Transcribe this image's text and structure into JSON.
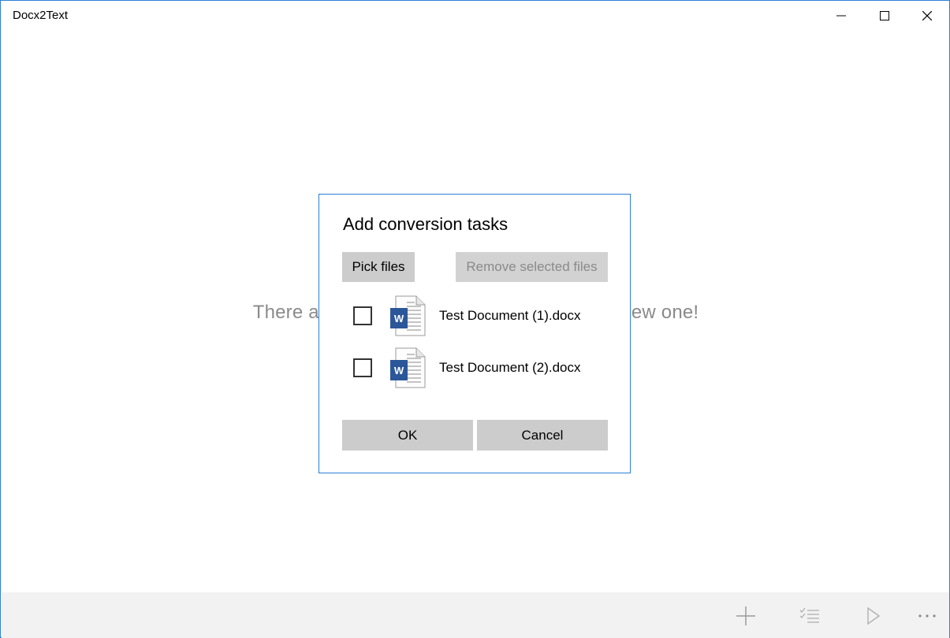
{
  "window": {
    "title": "Docx2Text",
    "controls": {
      "minimize_icon": "minimize-icon",
      "maximize_icon": "maximize-icon",
      "close_icon": "close-icon"
    }
  },
  "main": {
    "empty_message_left": "There a",
    "empty_message_right": "ew one!"
  },
  "command_bar": {
    "items": [
      {
        "icon": "add-icon"
      },
      {
        "icon": "select-all-icon"
      },
      {
        "icon": "play-icon"
      },
      {
        "icon": "more-icon"
      }
    ]
  },
  "dialog": {
    "title": "Add conversion tasks",
    "pick_files_label": "Pick files",
    "remove_selected_label": "Remove selected files",
    "files": [
      {
        "name": "Test Document (1).docx",
        "checked": false,
        "icon": "word-document-icon"
      },
      {
        "name": "Test Document (2).docx",
        "checked": false,
        "icon": "word-document-icon"
      }
    ],
    "ok_label": "OK",
    "cancel_label": "Cancel"
  },
  "colors": {
    "accent": "#2b7fd4",
    "word_blue": "#2b579a",
    "button_gray": "#cccccc",
    "disabled_text": "#8a8a8a",
    "command_bar_bg": "#f2f2f2"
  }
}
